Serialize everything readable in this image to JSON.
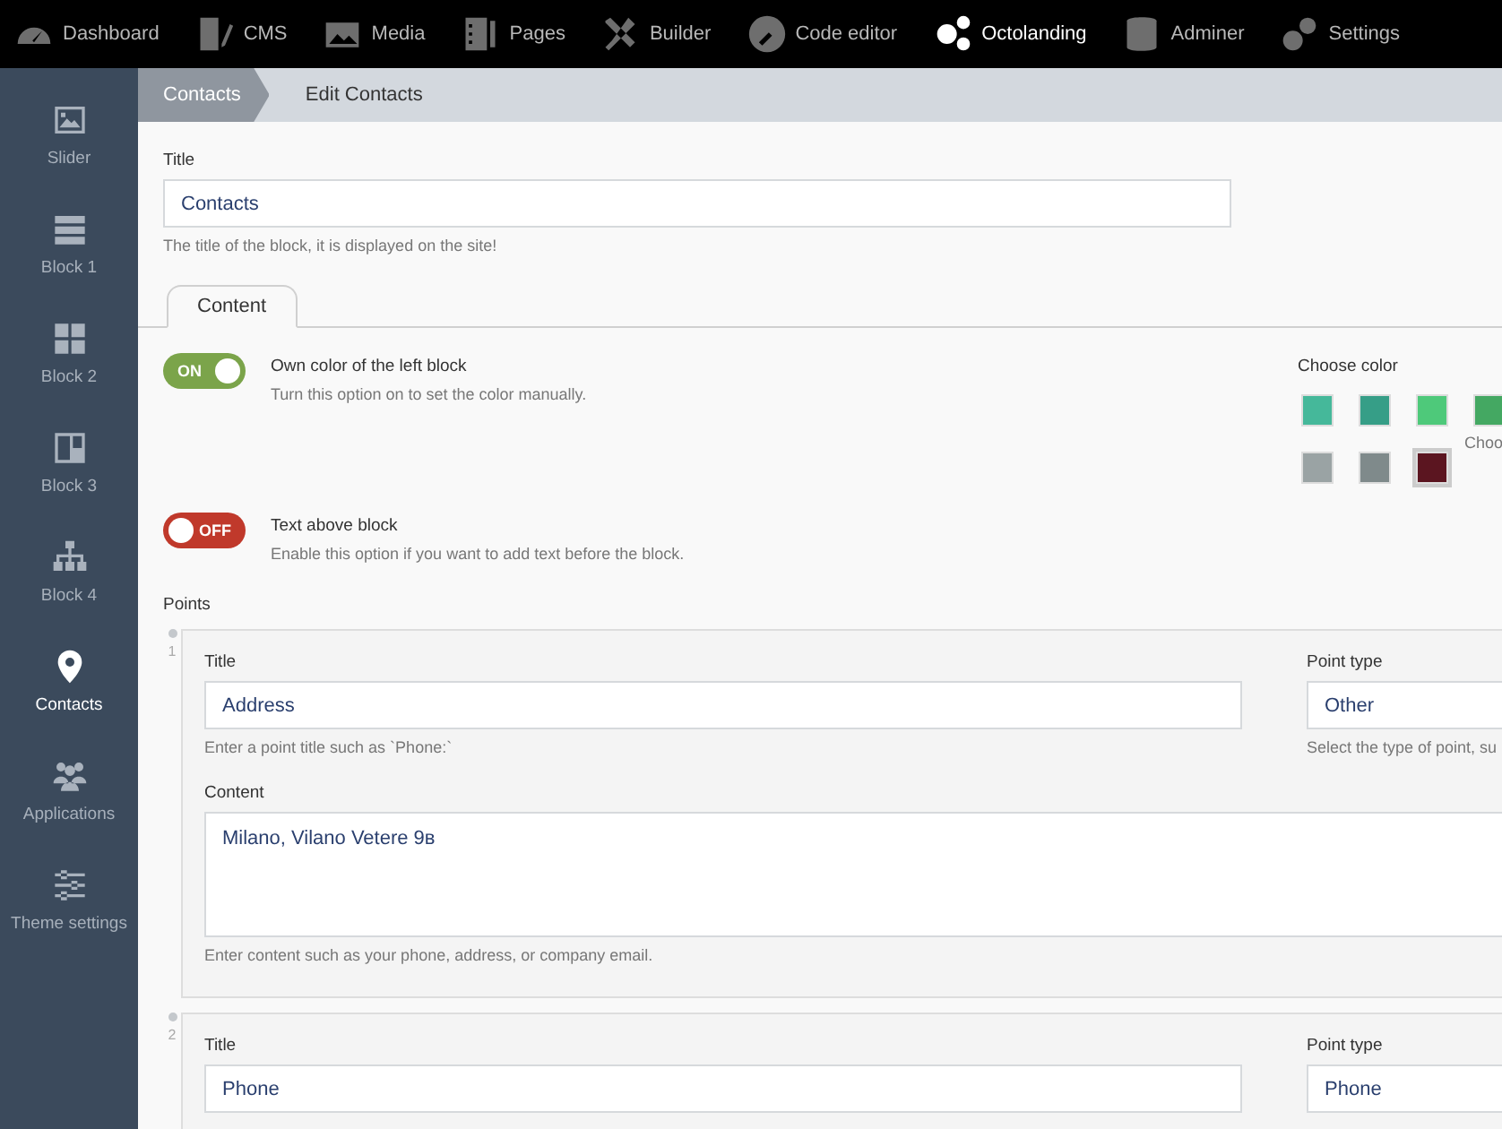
{
  "top_nav": [
    {
      "label": "Dashboard",
      "selected": false
    },
    {
      "label": "CMS",
      "selected": false
    },
    {
      "label": "Media",
      "selected": false
    },
    {
      "label": "Pages",
      "selected": false
    },
    {
      "label": "Builder",
      "selected": false
    },
    {
      "label": "Code editor",
      "selected": false
    },
    {
      "label": "Octolanding",
      "selected": true
    },
    {
      "label": "Adminer",
      "selected": false
    },
    {
      "label": "Settings",
      "selected": false
    }
  ],
  "sidebar": {
    "items": [
      {
        "label": "Slider",
        "selected": false
      },
      {
        "label": "Block 1",
        "selected": false
      },
      {
        "label": "Block 2",
        "selected": false
      },
      {
        "label": "Block 3",
        "selected": false
      },
      {
        "label": "Block 4",
        "selected": false
      },
      {
        "label": "Contacts",
        "selected": true
      },
      {
        "label": "Applications",
        "selected": false
      },
      {
        "label": "Theme settings",
        "selected": false
      }
    ]
  },
  "breadcrumb": [
    "Contacts",
    "Edit Contacts"
  ],
  "title_field": {
    "label": "Title",
    "value": "Contacts",
    "hint": "The title of the block, it is displayed on the site!"
  },
  "tabs": [
    {
      "label": "Content",
      "selected": true
    }
  ],
  "own_color": {
    "on": true,
    "text": "ON",
    "label": "Own color of the left block",
    "hint": "Turn this option on to set the color manually."
  },
  "color_chooser": {
    "label": "Choose color",
    "cut_label": "Choo",
    "swatches": [
      {
        "color": "#45b89a",
        "selected": false
      },
      {
        "color": "#369e87",
        "selected": false
      },
      {
        "color": "#4ec97a",
        "selected": false
      },
      {
        "color": "#44a862",
        "selected": false
      },
      {
        "color": "#9aa3a4",
        "selected": false
      },
      {
        "color": "#7f8a8b",
        "selected": false
      },
      {
        "color": "#5b1520",
        "selected": true
      }
    ]
  },
  "text_above": {
    "on": false,
    "text": "OFF",
    "label": "Text above block",
    "hint": "Enable this option if you want to add text before the block."
  },
  "points": {
    "label": "Points",
    "items": [
      {
        "number": "1",
        "title_label": "Title",
        "title": "Address",
        "title_hint": "Enter a point title such as `Phone:`",
        "type_label": "Point type",
        "type": "Other",
        "type_hint": "Select the type of point, su",
        "content_label": "Content",
        "content": "Milano, Vilano Vetere 9в",
        "content_hint": "Enter content such as your phone, address, or company email."
      },
      {
        "number": "2",
        "title_label": "Title",
        "title": "Phone",
        "type_label": "Point type",
        "type": "Phone"
      }
    ]
  }
}
